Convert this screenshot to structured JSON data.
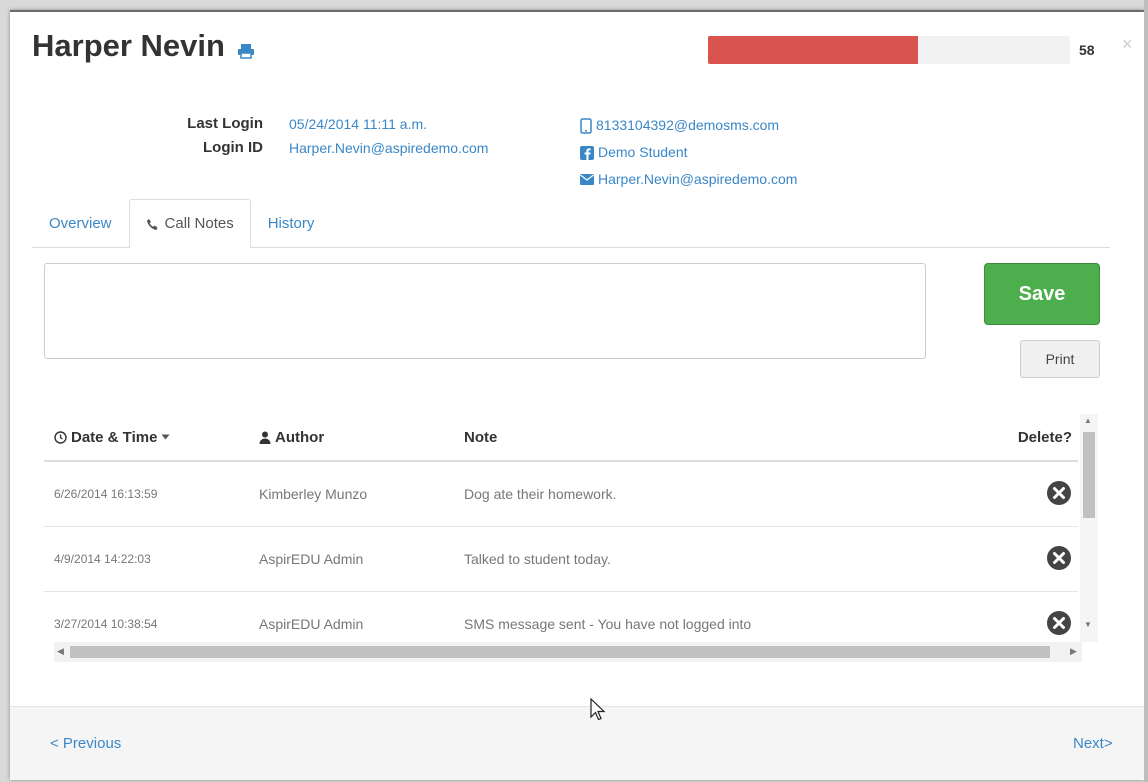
{
  "header": {
    "name": "Harper Nevin",
    "progress_percent": 58,
    "progress_value": "58",
    "close_symbol": "×"
  },
  "info": {
    "last_login_label": "Last Login",
    "last_login_value": "05/24/2014 11:11 a.m.",
    "login_id_label": "Login ID",
    "login_id_value": "Harper.Nevin@aspiredemo.com",
    "sms": "8133104392@demosms.com",
    "facebook": "Demo Student",
    "email": "Harper.Nevin@aspiredemo.com"
  },
  "tabs": [
    {
      "label": "Overview"
    },
    {
      "label": "Call Notes"
    },
    {
      "label": "History"
    }
  ],
  "actions": {
    "save_label": "Save",
    "print_label": "Print"
  },
  "table": {
    "headers": [
      "Date & Time",
      "Author",
      "Note",
      "Delete?"
    ],
    "rows": [
      {
        "date": "6/26/2014 16:13:59",
        "author": "Kimberley Munzo",
        "note": "Dog ate their homework."
      },
      {
        "date": "4/9/2014 14:22:03",
        "author": "AspirEDU Admin",
        "note": "Talked to student today."
      },
      {
        "date": "3/27/2014 10:38:54",
        "author": "AspirEDU Admin",
        "note": "SMS message sent - You have not logged into"
      }
    ]
  },
  "footer": {
    "previous_label": "< Previous",
    "next_label": "Next>"
  },
  "colors": {
    "accent": "#3a87c8",
    "progress": "#d9534f",
    "save": "#4cae4c"
  }
}
